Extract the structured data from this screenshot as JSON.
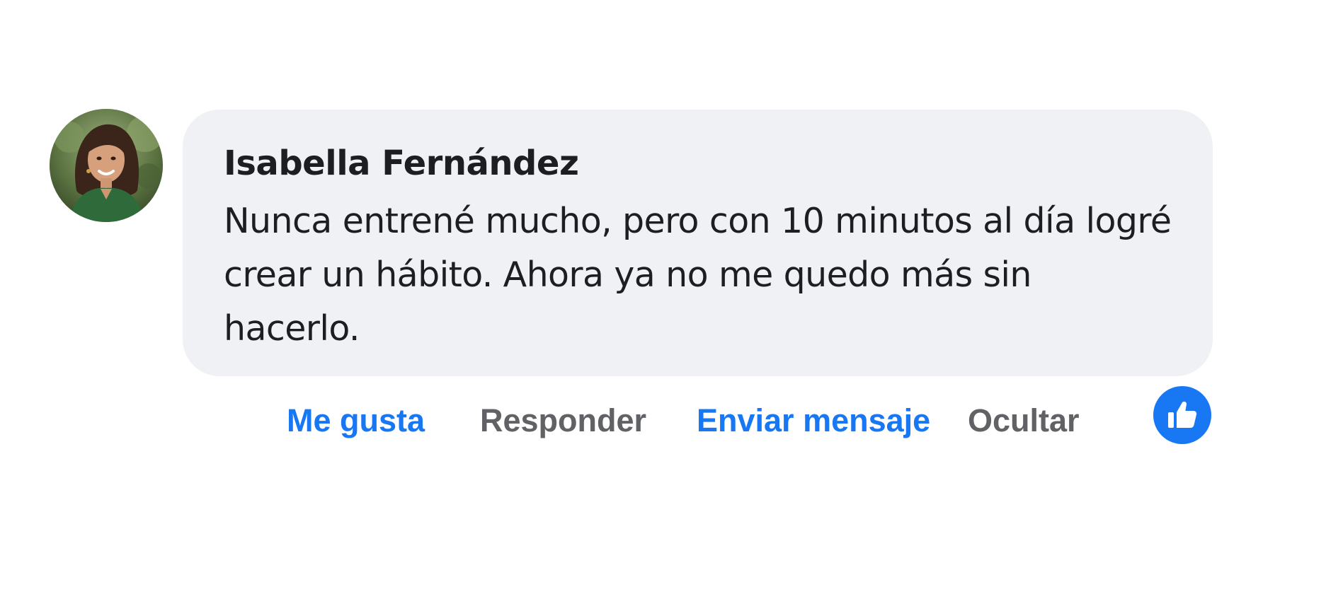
{
  "comment": {
    "author": "Isabella Fernández",
    "text": "Nunca entrené mucho, pero con 10 minutos al día logré crear un hábito. Ahora ya no me quedo más sin hacerlo.",
    "avatar_icon": "user-avatar-photo",
    "actions": {
      "like_label": "Me gusta",
      "reply_label": "Responder",
      "message_label": "Enviar mensaje",
      "hide_label": "Ocultar"
    },
    "reaction_icon": "thumbs-up-icon"
  },
  "colors": {
    "accent": "#1877f2",
    "muted_action": "#606266",
    "bubble": "#f0f1f4",
    "text": "#1c1e21"
  }
}
